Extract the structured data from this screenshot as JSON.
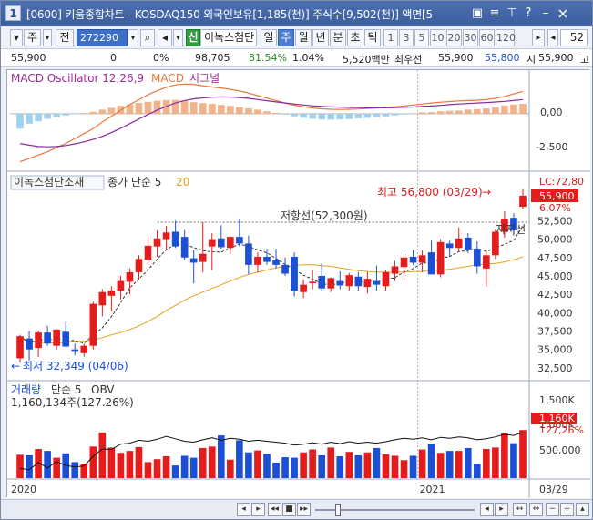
{
  "window": {
    "app_icon": "1",
    "title": "[0600] 키움종합차트 - KOSDAQ150 외국인보유[1,185(천)] 주식수[9,502(천)] 액면[5",
    "icons": [
      "restore-icon",
      "menu-icon",
      "pin-icon",
      "help-icon",
      "minimize-icon",
      "close-icon"
    ]
  },
  "toolbar": {
    "market": "주",
    "prev_label": "전",
    "code": "272290",
    "stock_name": "이녹스첨단",
    "stock_badge": "신",
    "periods": [
      "일",
      "주",
      "월",
      "년",
      "분",
      "초",
      "틱"
    ],
    "selected_period": "주",
    "intervals": [
      "1",
      "3",
      "5",
      "10",
      "20",
      "30",
      "60",
      "120"
    ],
    "count": "52"
  },
  "quote": {
    "price": "55,900",
    "change": "0",
    "change_pct": "0%",
    "volume": "98,705",
    "volume_ratio": "81.54%",
    "turnover_pct": "1.04%",
    "trade_value": "5,520백만",
    "best_ask_label": "최우선",
    "best_ask": "55,900",
    "best_bid": "55,800",
    "open_label": "시",
    "open": "55,900",
    "high_label": "고"
  },
  "macd_panel": {
    "label": "MACD Oscillator 12,26,9",
    "macd_label": "MACD",
    "signal_label": "시그널",
    "ticks": [
      "0,00",
      "-2,500"
    ]
  },
  "price_panel": {
    "stock_label": "이녹스첨단소재",
    "ma_label": "종가 단순 5",
    "ma_value": "20",
    "resistance_label": "저항선(52,300원)",
    "support_label": "지지선",
    "high_annotation": "최고 56,800 (03/29)",
    "low_annotation": "최저 32,349 (04/06)",
    "lc_label": "LC:72,80",
    "last_price_tag": "55,900",
    "pct_tag": "6,07%",
    "ticks": [
      "52,500",
      "50,000",
      "47,500",
      "45,000",
      "42,500",
      "40,000",
      "37,500",
      "35,000",
      "32,500"
    ]
  },
  "volume_panel": {
    "label": "거래량",
    "ma_label": "단순 5",
    "obv_label": "OBV",
    "summary": "1,160,134주(127.26%)",
    "ticks": [
      "1,500K",
      "1,000K",
      "500,000"
    ],
    "last_tag": "1,160K",
    "pct_tag": "127,26%"
  },
  "x_axis": {
    "labels": [
      "2020",
      "2021"
    ],
    "last_date": "03/29"
  },
  "chart_data": {
    "type": "candlestick",
    "candles": [
      {
        "o": 33800,
        "h": 37000,
        "l": 33200,
        "c": 36800
      },
      {
        "o": 36500,
        "h": 37500,
        "l": 33500,
        "c": 35000
      },
      {
        "o": 35200,
        "h": 37600,
        "l": 34000,
        "c": 37300
      },
      {
        "o": 37300,
        "h": 38200,
        "l": 35500,
        "c": 35800
      },
      {
        "o": 35500,
        "h": 37800,
        "l": 35000,
        "c": 37700
      },
      {
        "o": 37400,
        "h": 38800,
        "l": 35300,
        "c": 35400
      },
      {
        "o": 35000,
        "h": 35800,
        "l": 34200,
        "c": 34800
      },
      {
        "o": 34500,
        "h": 35800,
        "l": 34000,
        "c": 35500
      },
      {
        "o": 35500,
        "h": 41500,
        "l": 35000,
        "c": 41200
      },
      {
        "o": 41000,
        "h": 43200,
        "l": 39500,
        "c": 42800
      },
      {
        "o": 42300,
        "h": 43600,
        "l": 40200,
        "c": 43000
      },
      {
        "o": 43000,
        "h": 45000,
        "l": 41800,
        "c": 44300
      },
      {
        "o": 44200,
        "h": 46000,
        "l": 42500,
        "c": 45500
      },
      {
        "o": 45500,
        "h": 47800,
        "l": 44500,
        "c": 47300
      },
      {
        "o": 47200,
        "h": 50200,
        "l": 46500,
        "c": 49100
      },
      {
        "o": 49000,
        "h": 51200,
        "l": 47600,
        "c": 50100
      },
      {
        "o": 50000,
        "h": 51800,
        "l": 48600,
        "c": 50900
      },
      {
        "o": 51000,
        "h": 52500,
        "l": 48800,
        "c": 49000
      },
      {
        "o": 50300,
        "h": 51200,
        "l": 47200,
        "c": 47500
      },
      {
        "o": 47400,
        "h": 48500,
        "l": 44000,
        "c": 46800
      },
      {
        "o": 46900,
        "h": 52300,
        "l": 45500,
        "c": 48000
      },
      {
        "o": 49000,
        "h": 50800,
        "l": 45800,
        "c": 50000
      },
      {
        "o": 50100,
        "h": 51900,
        "l": 48700,
        "c": 48900
      },
      {
        "o": 48800,
        "h": 50400,
        "l": 48000,
        "c": 50300
      },
      {
        "o": 50300,
        "h": 52800,
        "l": 49000,
        "c": 49400
      },
      {
        "o": 49400,
        "h": 50500,
        "l": 45200,
        "c": 46500
      },
      {
        "o": 46500,
        "h": 48200,
        "l": 45500,
        "c": 47600
      },
      {
        "o": 47600,
        "h": 48700,
        "l": 46500,
        "c": 46900
      },
      {
        "o": 47200,
        "h": 48700,
        "l": 46000,
        "c": 46500
      },
      {
        "o": 46500,
        "h": 47500,
        "l": 45000,
        "c": 45300
      },
      {
        "o": 47600,
        "h": 48200,
        "l": 42200,
        "c": 43000
      },
      {
        "o": 42800,
        "h": 44500,
        "l": 42000,
        "c": 43800
      },
      {
        "o": 44000,
        "h": 45800,
        "l": 43200,
        "c": 44200
      },
      {
        "o": 45000,
        "h": 46700,
        "l": 43000,
        "c": 43300
      },
      {
        "o": 43300,
        "h": 44800,
        "l": 42800,
        "c": 44700
      },
      {
        "o": 44300,
        "h": 45600,
        "l": 43200,
        "c": 43700
      },
      {
        "o": 43600,
        "h": 45400,
        "l": 43000,
        "c": 45100
      },
      {
        "o": 44900,
        "h": 45500,
        "l": 43000,
        "c": 43600
      },
      {
        "o": 43500,
        "h": 45500,
        "l": 42600,
        "c": 44600
      },
      {
        "o": 44300,
        "h": 46400,
        "l": 43000,
        "c": 43800
      },
      {
        "o": 43600,
        "h": 45800,
        "l": 43000,
        "c": 45500
      },
      {
        "o": 45300,
        "h": 47000,
        "l": 44300,
        "c": 46300
      },
      {
        "o": 46200,
        "h": 48000,
        "l": 44500,
        "c": 47500
      },
      {
        "o": 47600,
        "h": 48500,
        "l": 46500,
        "c": 46800
      },
      {
        "o": 46800,
        "h": 48500,
        "l": 45500,
        "c": 47800
      },
      {
        "o": 48200,
        "h": 49800,
        "l": 46800,
        "c": 45200
      },
      {
        "o": 45200,
        "h": 50000,
        "l": 44800,
        "c": 49600
      },
      {
        "o": 49400,
        "h": 49800,
        "l": 47600,
        "c": 48800
      },
      {
        "o": 48800,
        "h": 51600,
        "l": 48300,
        "c": 50100
      },
      {
        "o": 50200,
        "h": 50800,
        "l": 48100,
        "c": 48600
      },
      {
        "o": 48700,
        "h": 49700,
        "l": 45300,
        "c": 46300
      },
      {
        "o": 46000,
        "h": 48500,
        "l": 43500,
        "c": 47800
      },
      {
        "o": 47800,
        "h": 51300,
        "l": 47300,
        "c": 51000
      },
      {
        "o": 51000,
        "h": 53800,
        "l": 50200,
        "c": 52800
      },
      {
        "o": 52900,
        "h": 53500,
        "l": 50500,
        "c": 51200
      },
      {
        "o": 54400,
        "h": 56800,
        "l": 54100,
        "c": 55900
      }
    ],
    "volume": [
      480,
      470,
      600,
      560,
      420,
      510,
      330,
      300,
      650,
      940,
      630,
      520,
      560,
      640,
      330,
      390,
      450,
      260,
      460,
      420,
      620,
      650,
      880,
      380,
      780,
      530,
      570,
      500,
      320,
      430,
      420,
      530,
      590,
      470,
      630,
      450,
      540,
      470,
      530,
      620,
      490,
      460,
      370,
      460,
      590,
      710,
      520,
      560,
      560,
      620,
      300,
      600,
      630,
      930,
      720,
      990
    ],
    "obv": [
      200,
      170,
      320,
      210,
      340,
      260,
      230,
      250,
      450,
      600,
      590,
      700,
      720,
      780,
      760,
      800,
      860,
      810,
      760,
      740,
      790,
      830,
      780,
      820,
      800,
      760,
      780,
      760,
      740,
      720,
      680,
      700,
      730,
      700,
      740,
      710,
      750,
      720,
      740,
      720,
      750,
      790,
      820,
      800,
      830,
      790,
      840,
      820,
      850,
      830,
      790,
      810,
      850,
      900,
      880,
      940
    ],
    "macd_hist": [
      -900,
      -600,
      -450,
      -300,
      -200,
      -100,
      -30,
      40,
      120,
      250,
      360,
      480,
      560,
      650,
      720,
      790,
      830,
      840,
      780,
      700,
      640,
      600,
      540,
      480,
      400,
      330,
      250,
      150,
      50,
      -50,
      -150,
      -240,
      -300,
      -340,
      -350,
      -340,
      -320,
      -280,
      -250,
      -200,
      -160,
      -100,
      -40,
      30,
      80,
      100,
      150,
      180,
      200,
      250,
      280,
      320,
      400,
      500,
      560,
      600
    ],
    "macd_line": [
      -2900,
      -2700,
      -2500,
      -2300,
      -2050,
      -1800,
      -1500,
      -1200,
      -900,
      -500,
      -150,
      200,
      550,
      850,
      1150,
      1400,
      1600,
      1750,
      1800,
      1780,
      1700,
      1620,
      1560,
      1480,
      1380,
      1250,
      1100,
      950,
      800,
      650,
      520,
      420,
      350,
      300,
      270,
      260,
      270,
      290,
      320,
      350,
      380,
      420,
      470,
      530,
      590,
      650,
      700,
      740,
      780,
      800,
      820,
      860,
      940,
      1050,
      1200,
      1350
    ],
    "signal_line": [
      -1800,
      -1900,
      -1980,
      -2000,
      -1980,
      -1920,
      -1820,
      -1700,
      -1550,
      -1370,
      -1140,
      -880,
      -600,
      -320,
      -40,
      220,
      450,
      650,
      800,
      900,
      960,
      1000,
      1020,
      1010,
      980,
      930,
      860,
      790,
      720,
      650,
      590,
      530,
      480,
      450,
      420,
      400,
      380,
      370,
      360,
      360,
      360,
      370,
      390,
      410,
      440,
      470,
      510,
      550,
      590,
      620,
      650,
      680,
      710,
      750,
      800,
      860
    ],
    "ma20": [
      36500,
      36200,
      36000,
      35900,
      35900,
      36000,
      36100,
      36100,
      36300,
      36600,
      37000,
      37300,
      37700,
      38200,
      38800,
      39500,
      40300,
      41000,
      41700,
      42300,
      42800,
      43300,
      43800,
      44300,
      44800,
      45200,
      45500,
      45800,
      46100,
      46300,
      46400,
      46500,
      46500,
      46400,
      46300,
      46100,
      45900,
      45700,
      45600,
      45500,
      45500,
      45500,
      45500,
      45600,
      45600,
      45700,
      45800,
      45900,
      46100,
      46300,
      46500,
      46600,
      46700,
      46900,
      47200,
      47600
    ],
    "ylim": [
      31500,
      57500
    ],
    "ylabel": "",
    "xlabel": ""
  }
}
